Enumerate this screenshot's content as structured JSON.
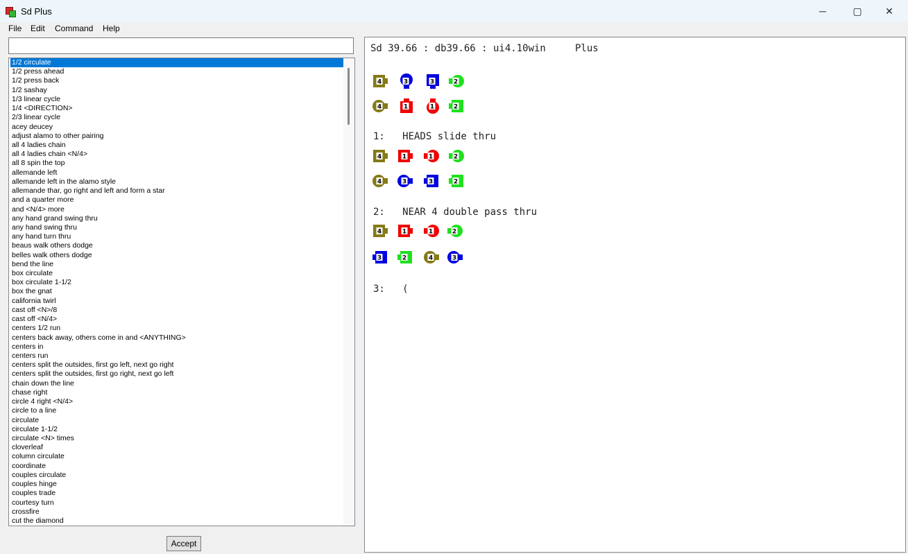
{
  "window": {
    "title": "Sd Plus",
    "minimize_glyph": "─",
    "maximize_glyph": "▢",
    "close_glyph": "✕"
  },
  "menu": {
    "items": [
      "File",
      "Edit",
      "Command",
      "Help"
    ]
  },
  "command_input": {
    "value": ""
  },
  "call_list": {
    "selected": "1/2 circulate",
    "items": [
      "1/2 circulate",
      "1/2 press ahead",
      "1/2 press back",
      "1/2 sashay",
      "1/3 linear cycle",
      "1/4 <DIRECTION>",
      "2/3 linear cycle",
      "acey deucey",
      "adjust alamo to other pairing",
      "all 4 ladies chain",
      "all 4 ladies chain <N/4>",
      "all 8 spin the top",
      "allemande left",
      "allemande left in the alamo style",
      "allemande thar, go right and left and form a star",
      "and a quarter more",
      "and <N/4> more",
      "any hand grand swing thru",
      "any hand swing thru",
      "any hand turn thru",
      "beaus walk others dodge",
      "belles walk others dodge",
      "bend the line",
      "box circulate",
      "box circulate 1-1/2",
      "box the gnat",
      "california twirl",
      "cast off <N>/8",
      "cast off <N/4>",
      "centers 1/2 run",
      "centers back away, others come in and <ANYTHING>",
      "centers in",
      "centers run",
      "centers split the outsides, first go left, next go right",
      "centers split the outsides, first go right, next go left",
      "chain down the line",
      "chase right",
      "circle 4 right <N/4>",
      "circle to a line",
      "circulate",
      "circulate 1-1/2",
      "circulate <N> times",
      "cloverleaf",
      "column circulate",
      "coordinate",
      "couples circulate",
      "couples hinge",
      "couples trade",
      "courtesy turn",
      "crossfire",
      "cut the diamond"
    ]
  },
  "accept_button": {
    "label": "Accept"
  },
  "output": {
    "header": "Sd 39.66 : db39.66 : ui4.10win     Plus",
    "steps": [
      {
        "label": "1:   HEADS slide thru"
      },
      {
        "label": "2:   NEAR 4 double pass thru"
      },
      {
        "label": "3:   ("
      }
    ]
  },
  "colors": {
    "couple1": "#f00000",
    "couple2": "#1fe01f",
    "couple3": "#0000e0",
    "couple4": "#857a16",
    "selection": "#0078d7"
  },
  "formations": [
    {
      "rows": [
        [
          {
            "n": "4",
            "shape": "square",
            "dir": "east",
            "color": "couple4"
          },
          {
            "n": "3",
            "shape": "circle",
            "dir": "south",
            "color": "couple3"
          },
          {
            "n": "3",
            "shape": "square",
            "dir": "south",
            "color": "couple3"
          },
          {
            "n": "2",
            "shape": "circle",
            "dir": "west",
            "color": "couple2"
          }
        ],
        [
          {
            "n": "4",
            "shape": "circle",
            "dir": "east",
            "color": "couple4"
          },
          {
            "n": "1",
            "shape": "square",
            "dir": "north",
            "color": "couple1"
          },
          {
            "n": "1",
            "shape": "circle",
            "dir": "north",
            "color": "couple1"
          },
          {
            "n": "2",
            "shape": "square",
            "dir": "west",
            "color": "couple2"
          }
        ]
      ]
    },
    {
      "rows": [
        [
          {
            "n": "4",
            "shape": "square",
            "dir": "east",
            "color": "couple4"
          },
          {
            "n": "1",
            "shape": "square",
            "dir": "east",
            "color": "couple1"
          },
          {
            "n": "1",
            "shape": "circle",
            "dir": "west",
            "color": "couple1"
          },
          {
            "n": "2",
            "shape": "circle",
            "dir": "west",
            "color": "couple2"
          }
        ],
        [
          {
            "n": "4",
            "shape": "circle",
            "dir": "east",
            "color": "couple4"
          },
          {
            "n": "3",
            "shape": "circle",
            "dir": "east",
            "color": "couple3"
          },
          {
            "n": "3",
            "shape": "square",
            "dir": "west",
            "color": "couple3"
          },
          {
            "n": "2",
            "shape": "square",
            "dir": "west",
            "color": "couple2"
          }
        ]
      ]
    },
    {
      "rows": [
        [
          {
            "n": "4",
            "shape": "square",
            "dir": "east",
            "color": "couple4"
          },
          {
            "n": "1",
            "shape": "square",
            "dir": "east",
            "color": "couple1"
          },
          {
            "n": "1",
            "shape": "circle",
            "dir": "west",
            "color": "couple1"
          },
          {
            "n": "2",
            "shape": "circle",
            "dir": "west",
            "color": "couple2"
          }
        ],
        [
          {
            "n": "3",
            "shape": "square",
            "dir": "west",
            "color": "couple3"
          },
          {
            "n": "2",
            "shape": "square",
            "dir": "west",
            "color": "couple2"
          },
          {
            "n": "4",
            "shape": "circle",
            "dir": "east",
            "color": "couple4"
          },
          {
            "n": "3",
            "shape": "circle",
            "dir": "east",
            "color": "couple3"
          }
        ]
      ]
    }
  ]
}
